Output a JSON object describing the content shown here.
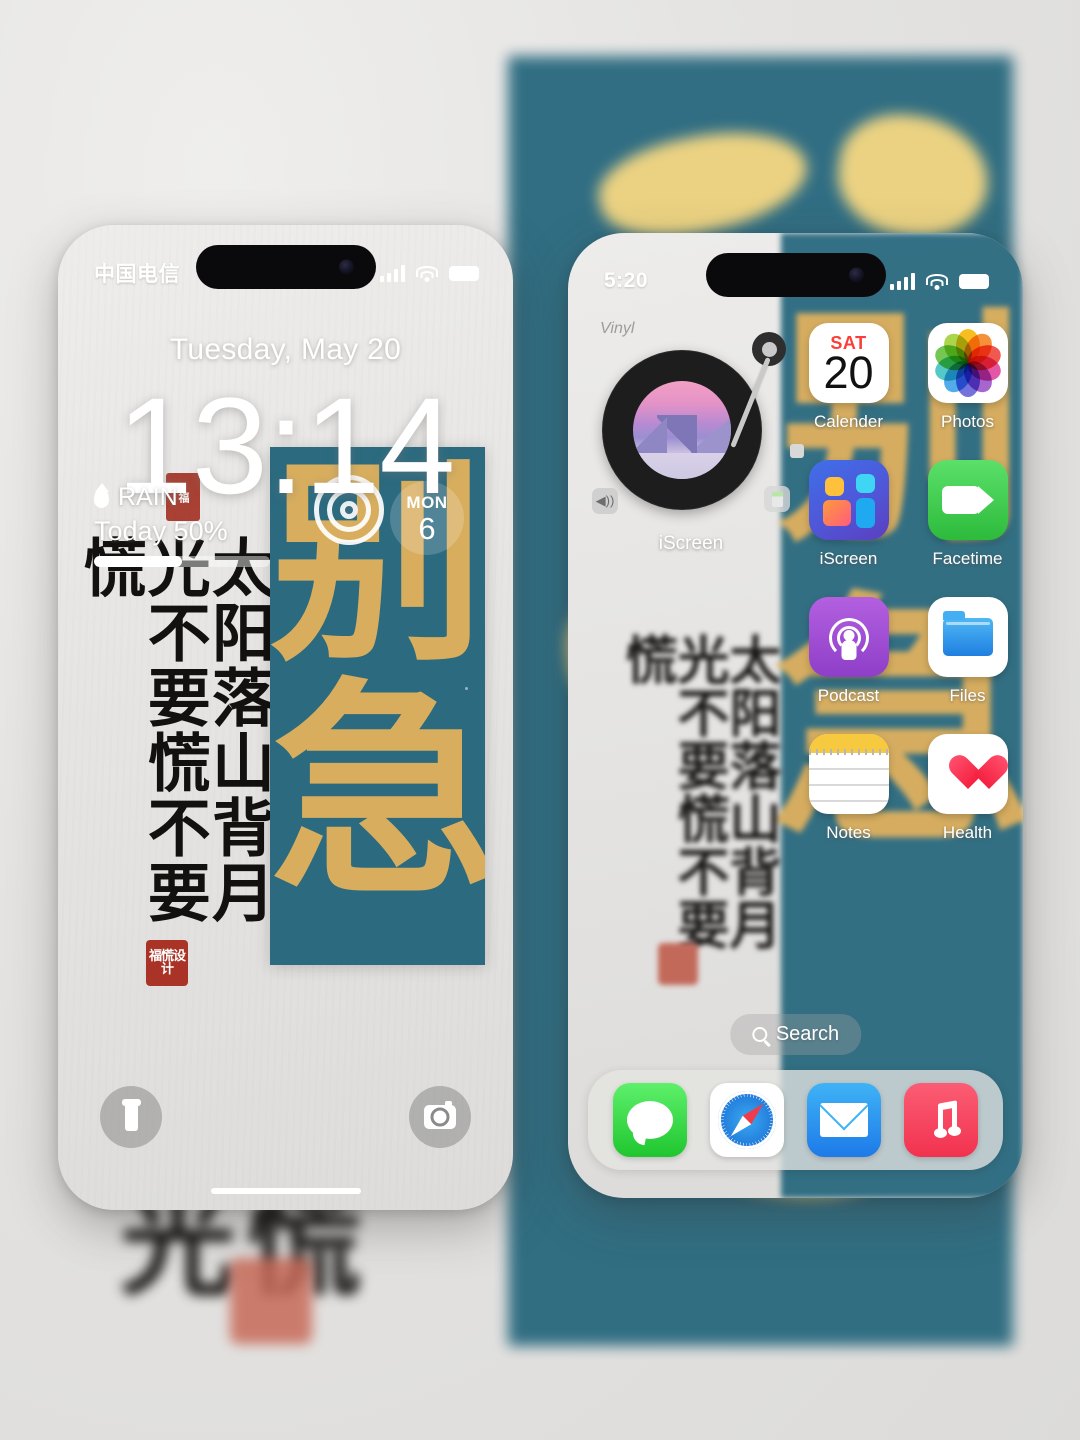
{
  "background": {
    "poster_color": "#2c6b80",
    "gold_color": "#d8ae5e",
    "calligraphy_blur_text": "光慌",
    "page_bg": "#e6e6e5"
  },
  "lock_screen": {
    "status_bar": {
      "carrier": "中国电信",
      "signal_icon": "cellular-bars-icon",
      "wifi_icon": "wifi-icon",
      "battery_icon": "battery-icon"
    },
    "date": "Tuesday, May 20",
    "time": "13:14",
    "wallpaper_calligraphy": "太阳落山背月光不要慌不要慌",
    "seal_text": "福慌设计",
    "weather_widget": {
      "icon": "rain-drop-icon",
      "label": "RAIN",
      "today_line": "Today 50%",
      "progress_percent": 50
    },
    "poster_widget": {
      "char_top": "别",
      "char_bottom": "急",
      "day_label": "MON",
      "day_number": "6",
      "rings_icon": "sound-rings-icon"
    },
    "flashlight_button": "flashlight-icon",
    "camera_button": "camera-icon"
  },
  "home_screen": {
    "status_bar": {
      "time": "5:20",
      "signal_icon": "cellular-bars-icon",
      "wifi_icon": "wifi-icon",
      "battery_icon": "battery-icon"
    },
    "vinyl_widget": {
      "label": "Vinyl",
      "app_name": "iScreen",
      "prev_icon": "speaker-icon",
      "next_icon": "battery-small-icon"
    },
    "wallpaper_poster": {
      "char_top": "别",
      "char_bottom": "急"
    },
    "wallpaper_calligraphy": "太阳落山背月光不要慌不要慌",
    "apps": [
      {
        "name": "Calender",
        "icon": "calendar-icon",
        "day_of_week": "SAT",
        "day_number": "20"
      },
      {
        "name": "Photos",
        "icon": "photos-icon"
      },
      {
        "name": "iScreen",
        "icon": "iscreen-icon"
      },
      {
        "name": "Facetime",
        "icon": "facetime-icon"
      },
      {
        "name": "Podcast",
        "icon": "podcast-icon"
      },
      {
        "name": "Files",
        "icon": "files-icon"
      },
      {
        "name": "Notes",
        "icon": "notes-icon"
      },
      {
        "name": "Health",
        "icon": "health-icon"
      }
    ],
    "search": {
      "label": "Search",
      "icon": "search-icon"
    },
    "dock": [
      {
        "name": "Messages",
        "icon": "messages-icon"
      },
      {
        "name": "Safari",
        "icon": "safari-icon"
      },
      {
        "name": "Mail",
        "icon": "mail-icon"
      },
      {
        "name": "Music",
        "icon": "music-icon"
      }
    ]
  }
}
